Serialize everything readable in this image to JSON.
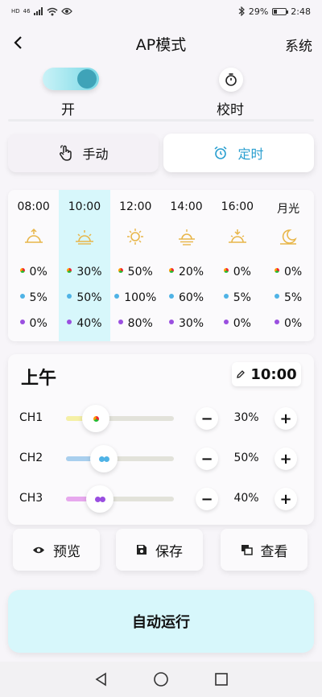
{
  "status_bar": {
    "network": "HD",
    "signal_label": "46",
    "battery_percent": "29%",
    "battery_level": 29,
    "time": "2:48"
  },
  "header": {
    "title": "AP模式",
    "system_link": "系统"
  },
  "toggles": {
    "power_label": "开",
    "sync_label": "校时"
  },
  "mode_tabs": [
    {
      "label": "手动",
      "selected": false
    },
    {
      "label": "定时",
      "selected": true
    }
  ],
  "schedule": [
    {
      "time": "08:00",
      "icon": "sunrise-icon",
      "ch1": "0%",
      "ch2": "5%",
      "ch3": "0%",
      "active": false
    },
    {
      "time": "10:00",
      "icon": "sun-rising-icon",
      "ch1": "30%",
      "ch2": "50%",
      "ch3": "40%",
      "active": true
    },
    {
      "time": "12:00",
      "icon": "sun-icon",
      "ch1": "50%",
      "ch2": "100%",
      "ch3": "80%",
      "active": false
    },
    {
      "time": "14:00",
      "icon": "sun-high-icon",
      "ch1": "20%",
      "ch2": "60%",
      "ch3": "30%",
      "active": false
    },
    {
      "time": "16:00",
      "icon": "sunset-icon",
      "ch1": "0%",
      "ch2": "5%",
      "ch3": "0%",
      "active": false
    },
    {
      "time": "月光",
      "icon": "moon-icon",
      "ch1": "0%",
      "ch2": "5%",
      "ch3": "0%",
      "active": false
    }
  ],
  "detail": {
    "period": "上午",
    "time": "10:00",
    "channels": [
      {
        "label": "CH1",
        "value_text": "30%",
        "value": 0.3,
        "color": "#f5f0a6"
      },
      {
        "label": "CH2",
        "value_text": "50%",
        "value": 0.5,
        "color": "#a9cfee"
      },
      {
        "label": "CH3",
        "value_text": "40%",
        "value": 0.4,
        "color": "#e7a8ee"
      }
    ],
    "minus_label": "−",
    "plus_label": "+"
  },
  "actions": {
    "preview_label": "预览",
    "save_label": "保存",
    "view_label": "查看"
  },
  "run_button_label": "自动运行",
  "colors": {
    "accent": "#2a9fd0",
    "active_bg": "#d7f7fb",
    "sun_icon": "#e8b64a"
  }
}
